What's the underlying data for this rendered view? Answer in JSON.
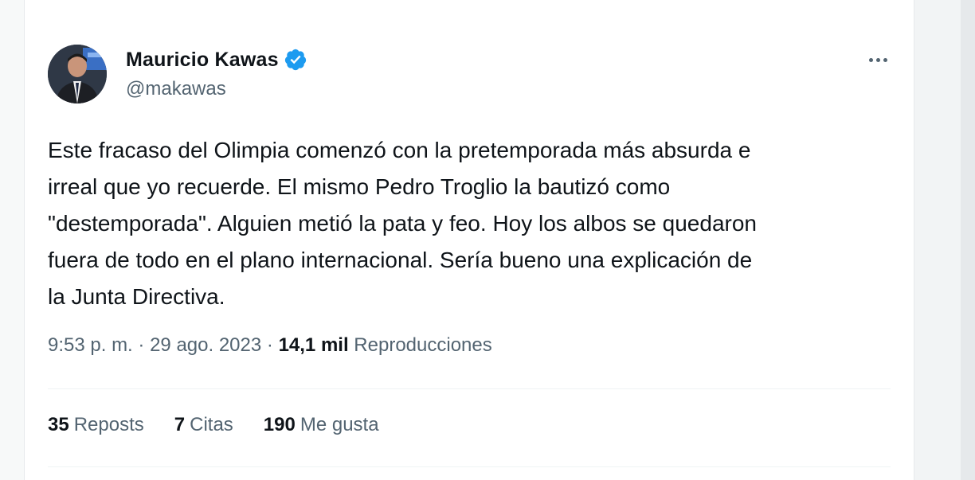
{
  "tweet": {
    "author_name": "Mauricio Kawas",
    "author_handle": "@makawas",
    "verified_icon": "verified-badge-icon",
    "verified_color": "#1d9bf0",
    "more_icon": "more-options-icon",
    "text": "Este fracaso del Olimpia comenzó con la pretemporada más absurda e\nirreal que yo recuerde. El mismo Pedro Troglio la bautizó como\n\"destemporada\".  Alguien metió la pata y feo.  Hoy los albos se quedaron\nfuera de todo en el plano internacional.  Sería bueno una explicación de\nla Junta Directiva.",
    "time": "9:53 p. m.",
    "separator": "·",
    "date": "29 ago. 2023",
    "views_count": "14,1 mil",
    "views_label": "Reproducciones"
  },
  "stats": {
    "reposts_count": "35",
    "reposts_label": "Reposts",
    "quotes_count": "7",
    "quotes_label": "Citas",
    "likes_count": "190",
    "likes_label": "Me gusta"
  }
}
